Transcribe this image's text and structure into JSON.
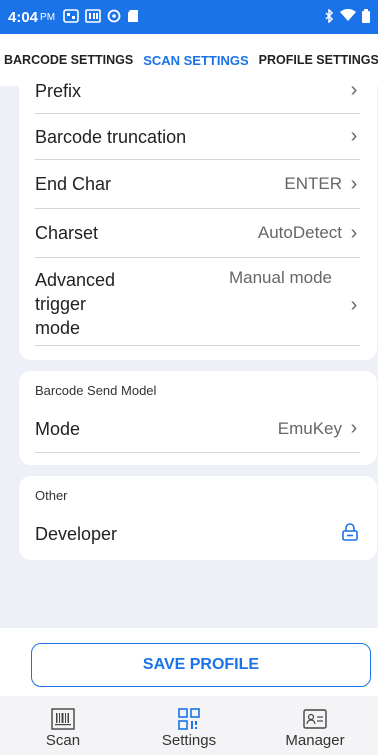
{
  "status_bar": {
    "time": "4:04",
    "ampm": "PM"
  },
  "tabs": [
    {
      "label": "BARCODE SETTINGS"
    },
    {
      "label": "SCAN SETTINGS"
    },
    {
      "label": "PROFILE SETTINGS"
    }
  ],
  "scan_settings": {
    "prefix": {
      "label": "Prefix"
    },
    "barcode_truncation": {
      "label": "Barcode truncation"
    },
    "end_char": {
      "label": "End Char",
      "value": "ENTER"
    },
    "charset": {
      "label": "Charset",
      "value": "AutoDetect"
    },
    "advanced_trigger": {
      "label": "Advanced\ntrigger\nmode",
      "value": "Manual mode"
    }
  },
  "barcode_send_model": {
    "title": "Barcode Send Model",
    "mode": {
      "label": "Mode",
      "value": "EmuKey"
    }
  },
  "other": {
    "title": "Other",
    "developer": {
      "label": "Developer"
    }
  },
  "save_button": {
    "label": "SAVE PROFILE"
  },
  "bottom_nav": [
    {
      "label": "Scan",
      "icon": "barcode-icon"
    },
    {
      "label": "Settings",
      "icon": "qr-settings-icon"
    },
    {
      "label": "Manager",
      "icon": "contact-card-icon"
    }
  ],
  "accent_color": "#1a73e8"
}
